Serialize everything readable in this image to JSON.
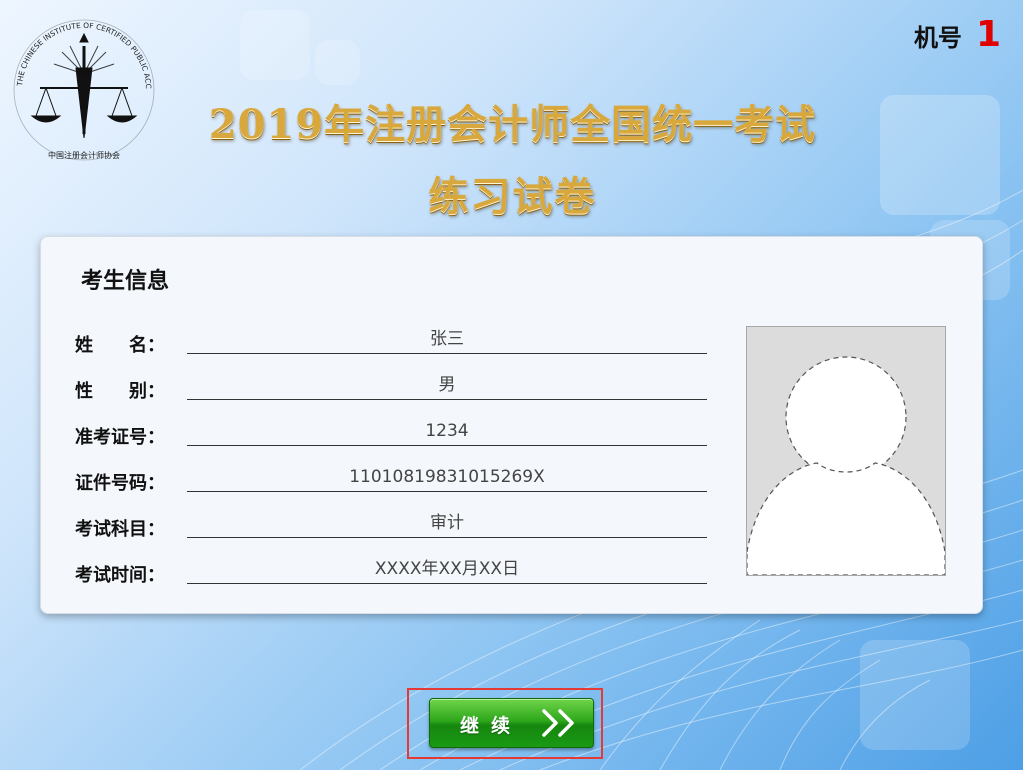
{
  "header": {
    "title_line1": "2019年注册会计师全国统一考试",
    "title_line2": "练习试卷",
    "machine_label": "机号",
    "machine_number": "1"
  },
  "logo": {
    "ring_text": "THE CHINESE INSTITUTE OF CERTIFIED PUBLIC ACCOUNTANTS",
    "bottom_text": "中国注册会计师协会",
    "icon": "scales-of-justice-icon"
  },
  "candidate_info": {
    "title": "考生信息",
    "fields": [
      {
        "label": "姓　　名：",
        "value": "张三"
      },
      {
        "label": "性　　别：",
        "value": "男"
      },
      {
        "label": "准考证号：",
        "value": "1234"
      },
      {
        "label": "证件号码：",
        "value": "11010819831015269X"
      },
      {
        "label": "考试科目：",
        "value": "审计"
      },
      {
        "label": "考试时间：",
        "value": "XXXX年XX月XX日"
      }
    ],
    "photo_icon": "person-silhouette-icon"
  },
  "actions": {
    "continue_label": "继续",
    "continue_icon": "double-chevron-right-icon"
  },
  "colors": {
    "accent_green": "#2fa81c",
    "machine_number_red": "#e00000",
    "title_gold": "#d9a83c",
    "highlight_red": "#e53935"
  }
}
